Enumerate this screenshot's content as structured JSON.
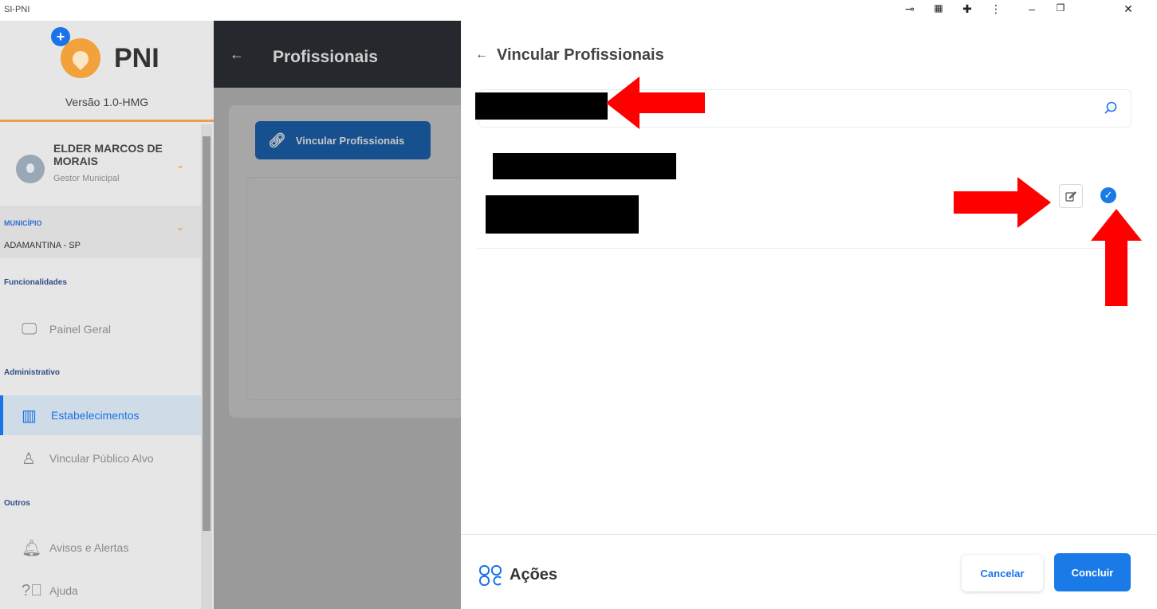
{
  "window": {
    "title": "SI-PNI",
    "controls": [
      "key-icon",
      "translate-icon",
      "extension-icon",
      "more-icon",
      "minimize",
      "restore",
      "close"
    ]
  },
  "sidebar": {
    "logo_text": "PNI",
    "version": "Versão 1.0-HMG",
    "user": {
      "name": "ELDER MARCOS DE MORAIS",
      "role": "Gestor Municipal"
    },
    "municipio": {
      "label": "MUNICÍPIO",
      "value": "ADAMANTINA - SP"
    },
    "sections": {
      "funcionalidades": "Funcionalidades",
      "administrativo": "Administrativo",
      "outros": "Outros"
    },
    "items": [
      {
        "label": "Painel Geral",
        "icon": "monitor-icon"
      },
      {
        "label": "Estabelecimentos",
        "icon": "building-icon",
        "active": true
      },
      {
        "label": "Vincular Público Alvo",
        "icon": "user-check-icon"
      },
      {
        "label": "Avisos e Alertas",
        "icon": "bell-icon"
      },
      {
        "label": "Ajuda",
        "icon": "help-icon"
      }
    ]
  },
  "main": {
    "title": "Profissionais",
    "vincular_button": "Vincular Profissionais"
  },
  "drawer": {
    "title": "Vincular Profissionais",
    "search": {
      "value": "",
      "placeholder": ""
    },
    "footer": {
      "acoes_label": "Ações",
      "cancel_label": "Cancelar",
      "conclude_label": "Concluir"
    }
  },
  "colors": {
    "primary": "#1a7ae8",
    "accent_orange": "#f2a23a",
    "annotation_red": "#ff0000"
  }
}
